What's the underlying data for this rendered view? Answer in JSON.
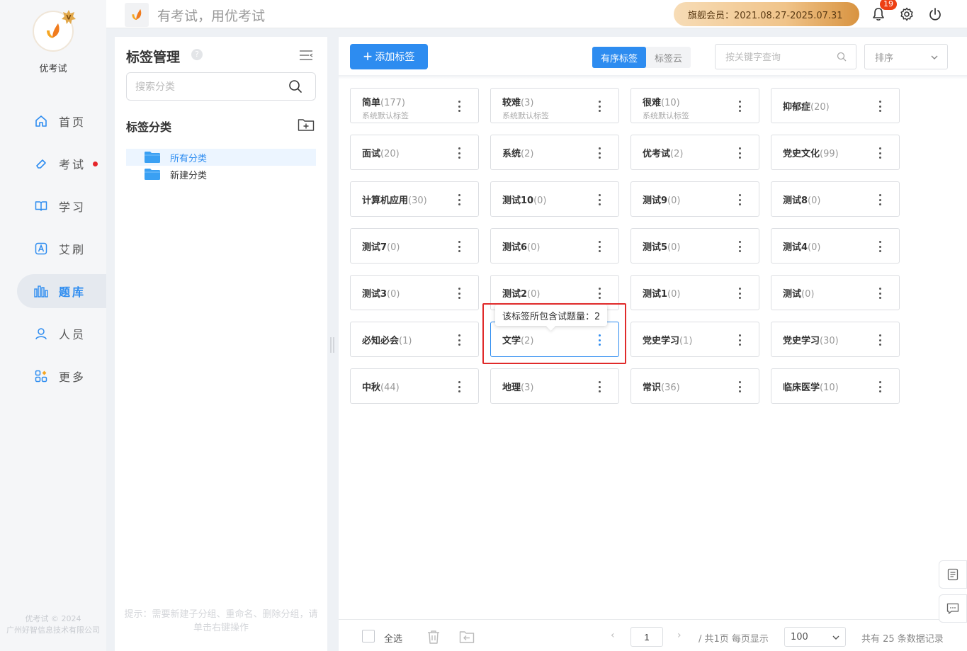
{
  "app": {
    "name": "优考试",
    "slogan": "有考试，用优考试",
    "copyright_line1": "优考试 © 2024",
    "copyright_line2": "广州好智信息技术有限公司"
  },
  "nav": {
    "items": [
      {
        "label": "首页",
        "icon": "home-icon"
      },
      {
        "label": "考试",
        "icon": "eraser-icon",
        "dot": true
      },
      {
        "label": "学习",
        "icon": "book-icon"
      },
      {
        "label": "艾刷",
        "icon": "a-badge-icon"
      },
      {
        "label": "题库",
        "icon": "bar-chart-icon",
        "active": true
      },
      {
        "label": "人员",
        "icon": "user-icon"
      },
      {
        "label": "更多",
        "icon": "grid-icon"
      }
    ]
  },
  "topbar": {
    "vip_text": "旗舰会员：2021.08.27-2025.07.31",
    "notification_count": "19"
  },
  "category_panel": {
    "title": "标签管理",
    "help_mark": "?",
    "search_placeholder": "搜索分类",
    "section_title": "标签分类",
    "tree": [
      {
        "label": "所有分类",
        "selected": true
      },
      {
        "label": "新建分类"
      }
    ],
    "tip": "提示：需要新建子分组、重命名、删除分组，请单击右键操作"
  },
  "main": {
    "add_button": "添加标签",
    "tabs": [
      {
        "label": "有序标签",
        "active": true
      },
      {
        "label": "标签云"
      }
    ],
    "keyword_placeholder": "按关键字查询",
    "sort_label": "排序",
    "tags": [
      {
        "name": "简单",
        "count": "(177)",
        "sub": "系统默认标签"
      },
      {
        "name": "较难",
        "count": "(3)",
        "sub": "系统默认标签"
      },
      {
        "name": "很难",
        "count": "(10)",
        "sub": "系统默认标签"
      },
      {
        "name": "抑郁症",
        "count": "(20)"
      },
      {
        "name": "面试",
        "count": "(20)"
      },
      {
        "name": "系统",
        "count": "(2)"
      },
      {
        "name": "优考试",
        "count": "(2)"
      },
      {
        "name": "党史文化",
        "count": "(99)"
      },
      {
        "name": "计算机应用",
        "count": "(30)"
      },
      {
        "name": "测试10",
        "count": "(0)"
      },
      {
        "name": "测试9",
        "count": "(0)"
      },
      {
        "name": "测试8",
        "count": "(0)"
      },
      {
        "name": "测试7",
        "count": "(0)"
      },
      {
        "name": "测试6",
        "count": "(0)"
      },
      {
        "name": "测试5",
        "count": "(0)"
      },
      {
        "name": "测试4",
        "count": "(0)"
      },
      {
        "name": "测试3",
        "count": "(0)"
      },
      {
        "name": "测试2",
        "count": "(0)"
      },
      {
        "name": "测试1",
        "count": "(0)"
      },
      {
        "name": "测试",
        "count": "(0)"
      },
      {
        "name": "必知必会",
        "count": "(1)"
      },
      {
        "name": "文学",
        "count": "(2)",
        "hover": true
      },
      {
        "name": "党史学习",
        "count": "(1)"
      },
      {
        "name": "党史学习",
        "count": "(30)"
      },
      {
        "name": "中秋",
        "count": "(44)"
      },
      {
        "name": "地理",
        "count": "(3)"
      },
      {
        "name": "常识",
        "count": "(36)"
      },
      {
        "name": "临床医学",
        "count": "(10)"
      }
    ],
    "tooltip": "该标签所包含试题量：2"
  },
  "footer": {
    "select_all": "全选",
    "page_value": "1",
    "page_info": "/ 共1页 每页显示",
    "page_size": "100",
    "total": "共有 25 条数据记录"
  },
  "colors": {
    "primary": "#2d8cf0",
    "highlight": "#e02a2a",
    "badge": "#ed4014"
  }
}
